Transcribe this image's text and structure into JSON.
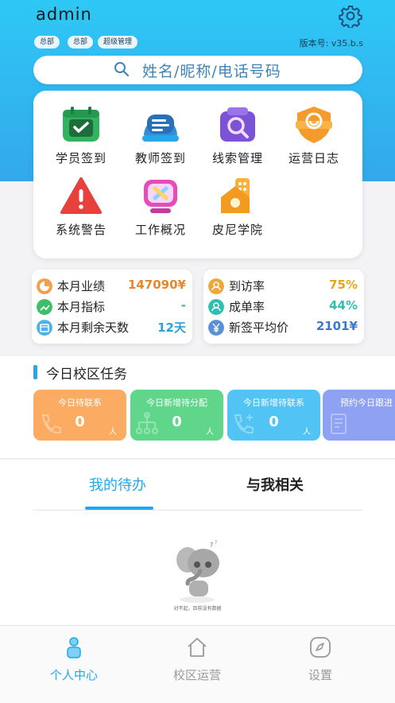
{
  "header": {
    "username": "admin",
    "tags": [
      "总部",
      "总部",
      "超级管理"
    ],
    "version": "版本号: v35.b.s"
  },
  "search": {
    "placeholder": "姓名/昵称/电话号码"
  },
  "menu_items": [
    {
      "label": "学员签到",
      "icon": "calendar-check-icon"
    },
    {
      "label": "教师签到",
      "icon": "teacher-icon"
    },
    {
      "label": "线索管理",
      "icon": "magnifier-icon"
    },
    {
      "label": "运营日志",
      "icon": "log-badge-icon"
    },
    {
      "label": "系统警告",
      "icon": "warning-icon"
    },
    {
      "label": "工作概况",
      "icon": "work-overview-icon"
    },
    {
      "label": "皮尼学院",
      "icon": "college-icon"
    }
  ],
  "stats_left": [
    {
      "label": "本月业绩",
      "value": "147090¥",
      "color": "#e8862c"
    },
    {
      "label": "本月指标",
      "value": "-",
      "color": "#3cbf69"
    },
    {
      "label": "本月剩余天数",
      "value": "12天",
      "color": "#2ea0db"
    }
  ],
  "stats_right": [
    {
      "label": "到访率",
      "value": "75%",
      "color": "#e9a51f"
    },
    {
      "label": "成单率",
      "value": "44%",
      "color": "#2fbfb0"
    },
    {
      "label": "新签平均价",
      "value": "2101¥",
      "color": "#3c78c9"
    }
  ],
  "section": {
    "title": "今日校区任务"
  },
  "tasks": [
    {
      "title": "今日待联系",
      "count": "0",
      "unit": "人",
      "color": "#fbac62"
    },
    {
      "title": "今日新增待分配",
      "count": "0",
      "unit": "人",
      "color": "#5fd68a"
    },
    {
      "title": "今日新增待联系",
      "count": "0",
      "unit": "人",
      "color": "#52c3f5"
    },
    {
      "title": "预约今日跟进",
      "count": "",
      "unit": "",
      "color": "#8ea1f3"
    }
  ],
  "tabs": {
    "active": "我的待办",
    "other": "与我相关"
  },
  "empty": {
    "message": "对不起，目前没有数据"
  },
  "nav": [
    {
      "label": "个人中心",
      "active": true
    },
    {
      "label": "校区运营",
      "active": false
    },
    {
      "label": "设置",
      "active": false
    }
  ],
  "colors": {
    "accent": "#1ea9ec",
    "header_top": "#2ec8f6",
    "nav_inactive": "#999999"
  }
}
